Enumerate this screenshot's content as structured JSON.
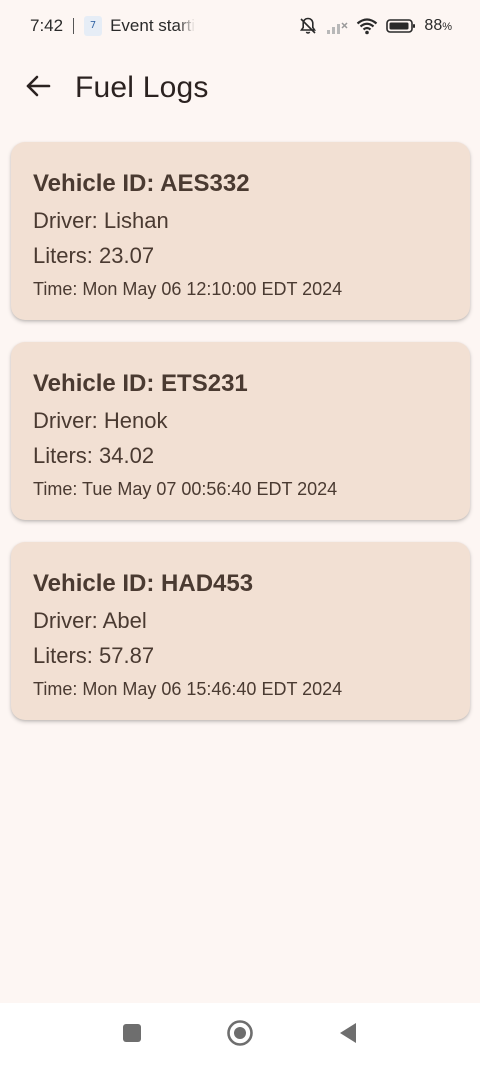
{
  "status_bar": {
    "time": "7:42",
    "notification_icon_text": "7",
    "event_text": "Event starti",
    "battery_percent": "88",
    "battery_suffix": "%"
  },
  "app_bar": {
    "title": "Fuel Logs"
  },
  "logs": [
    {
      "vehicle": "Vehicle ID: AES332",
      "driver": "Driver: Lishan",
      "liters": "Liters: 23.07",
      "time": "Time: Mon May 06 12:10:00 EDT 2024"
    },
    {
      "vehicle": "Vehicle ID: ETS231",
      "driver": "Driver: Henok",
      "liters": "Liters: 34.02",
      "time": "Time: Tue May 07 00:56:40 EDT 2024"
    },
    {
      "vehicle": "Vehicle ID: HAD453",
      "driver": "Driver: Abel",
      "liters": "Liters: 57.87",
      "time": "Time: Mon May 06 15:46:40 EDT 2024"
    }
  ],
  "colors": {
    "background": "#fdf6f3",
    "card": "#f2e0d3",
    "card_text": "#4a3a31"
  },
  "icons": {
    "back": "arrow-left-icon",
    "bell_muted": "bell-off-icon",
    "signal": "signal-bars-icon",
    "wifi": "wifi-icon",
    "battery": "battery-icon",
    "nav_recents": "square-icon",
    "nav_home": "circle-icon",
    "nav_back": "triangle-back-icon"
  }
}
